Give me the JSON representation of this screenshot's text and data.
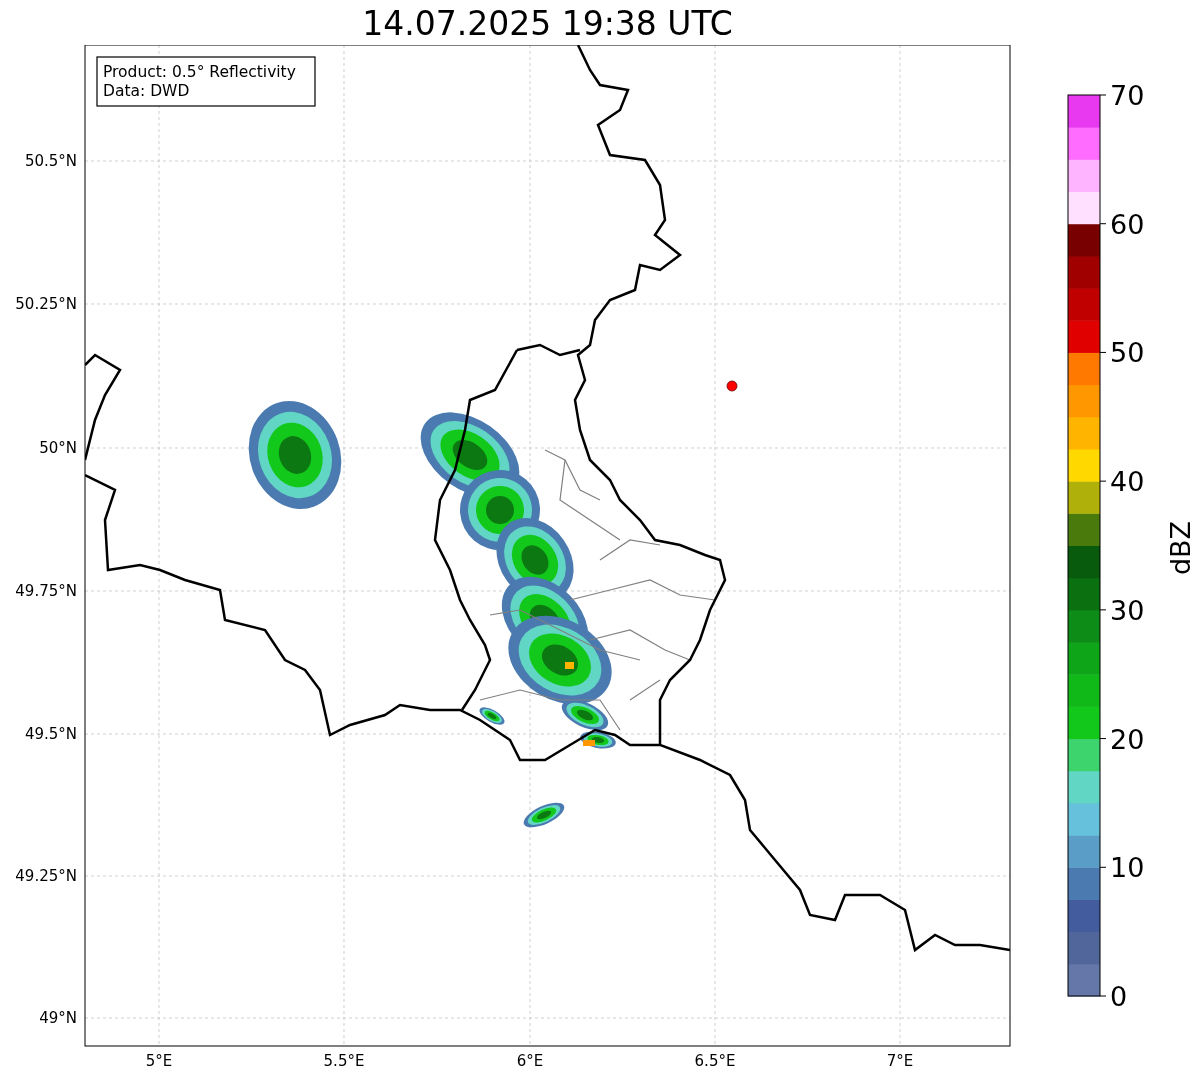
{
  "title": "14.07.2025 19:38 UTC",
  "map": {
    "info": [
      "Product: 0.5° Reflectivity",
      "Data: DWD"
    ],
    "lat_ticks": [
      "50.5°N",
      "50.25°N",
      "50°N",
      "49.75°N",
      "49.5°N",
      "49.25°N",
      "49°N"
    ],
    "lon_ticks": [
      "5°E",
      "5.5°E",
      "6°E",
      "6.5°E",
      "7°E"
    ]
  },
  "colorbar": {
    "label": "dBZ",
    "ticks": [
      "70",
      "60",
      "50",
      "40",
      "30",
      "20",
      "10",
      "0"
    ],
    "bins": [
      {
        "color": "#6577a8"
      },
      {
        "color": "#51679c"
      },
      {
        "color": "#425c9e"
      },
      {
        "color": "#4a7ab0"
      },
      {
        "color": "#5a9dc6"
      },
      {
        "color": "#66c2dc"
      },
      {
        "color": "#62d6c4"
      },
      {
        "color": "#3dd46e"
      },
      {
        "color": "#12c81a"
      },
      {
        "color": "#10b818"
      },
      {
        "color": "#0fa518"
      },
      {
        "color": "#0d8c18"
      },
      {
        "color": "#0a7010"
      },
      {
        "color": "#085a0c"
      },
      {
        "color": "#4a7a0c"
      },
      {
        "color": "#b0b00a"
      },
      {
        "color": "#ffd800"
      },
      {
        "color": "#ffb400"
      },
      {
        "color": "#ff9800"
      },
      {
        "color": "#ff7800"
      },
      {
        "color": "#e00000"
      },
      {
        "color": "#c00000"
      },
      {
        "color": "#a00000"
      },
      {
        "color": "#780000"
      },
      {
        "color": "#ffe0ff"
      },
      {
        "color": "#ffb4ff"
      },
      {
        "color": "#ff6cff"
      },
      {
        "color": "#e838f0"
      }
    ]
  }
}
